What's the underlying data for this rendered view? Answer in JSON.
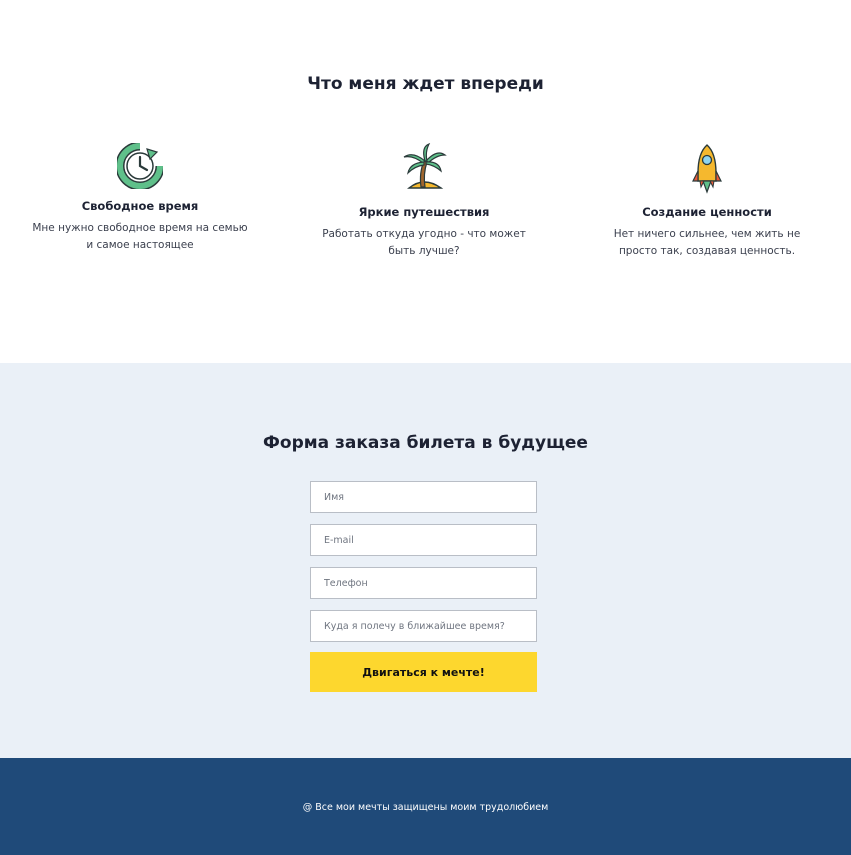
{
  "features": {
    "title": "Что меня ждет впереди",
    "items": [
      {
        "icon": "clock-icon",
        "title": "Свободное время",
        "text": "Мне нужно свободное время на семью и самое настоящее"
      },
      {
        "icon": "palm-island-icon",
        "title": "Яркие путешествия",
        "text": "Работать откуда угодно - что может быть лучше?"
      },
      {
        "icon": "rocket-icon",
        "title": "Создание ценности",
        "text": "Нет ничего сильнее, чем жить не просто так, создавая ценность."
      }
    ]
  },
  "order_form": {
    "title": "Форма заказа билета в будущее",
    "fields": {
      "name_placeholder": "Имя",
      "email_placeholder": "E-mail",
      "phone_placeholder": "Телефон",
      "destination_placeholder": "Куда я полечу в ближайшее время?"
    },
    "submit_label": "Двигаться к мечте!"
  },
  "footer": {
    "text": "@ Все мои мечты защищены моим трудолюбием"
  },
  "colors": {
    "form_section_bg": "#eaf0f7",
    "submit_bg": "#fdd72e",
    "footer_bg": "#1f4a79"
  }
}
